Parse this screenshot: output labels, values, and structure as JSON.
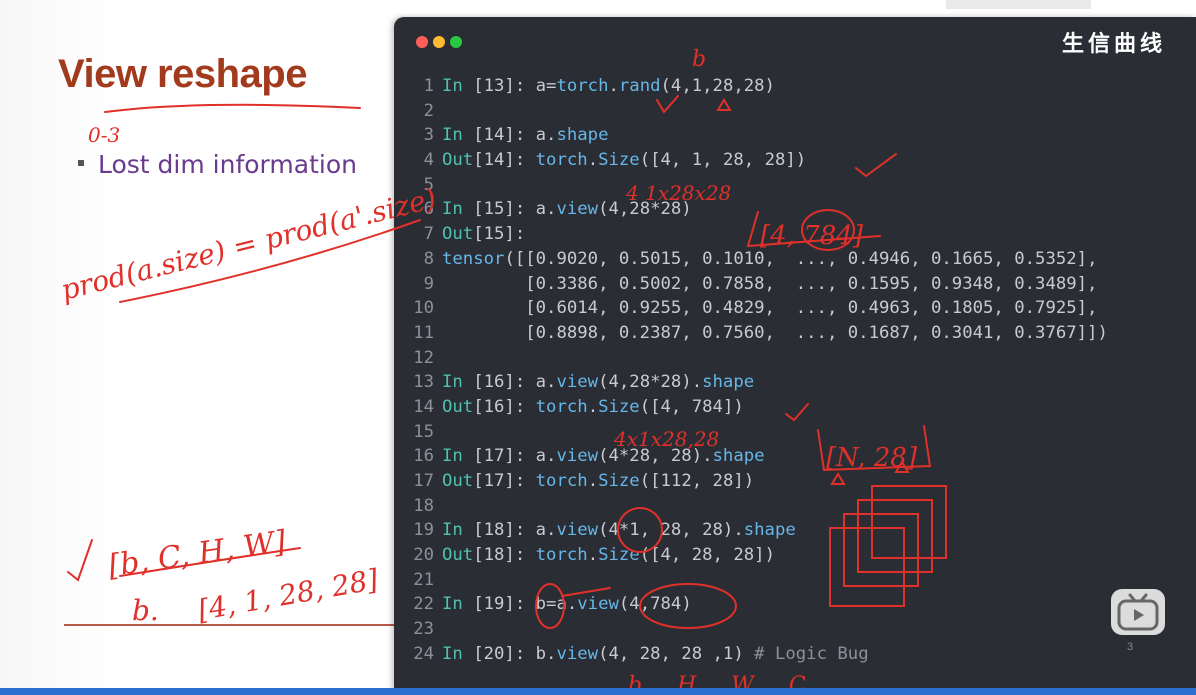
{
  "slide": {
    "title": "View reshape",
    "bullet": "Lost dim information"
  },
  "terminal": {
    "watermark": "生信曲线",
    "lines": [
      {
        "n": "1",
        "parts": [
          [
            "kw",
            "In "
          ],
          [
            "",
            "[13]: a="
          ],
          [
            "fn",
            "torch"
          ],
          [
            "",
            "."
          ],
          [
            "fn",
            "rand"
          ],
          [
            "",
            "(4,1,28,28)"
          ]
        ]
      },
      {
        "n": "2",
        "parts": []
      },
      {
        "n": "3",
        "parts": [
          [
            "kw",
            "In "
          ],
          [
            "",
            "[14]: a."
          ],
          [
            "fn",
            "shape"
          ]
        ]
      },
      {
        "n": "4",
        "parts": [
          [
            "kw",
            "Out"
          ],
          [
            "",
            "[14]: "
          ],
          [
            "fn",
            "torch"
          ],
          [
            "",
            "."
          ],
          [
            "fn",
            "Size"
          ],
          [
            "",
            "([4, 1, 28, 28])"
          ]
        ]
      },
      {
        "n": "5",
        "parts": []
      },
      {
        "n": "6",
        "parts": [
          [
            "kw",
            "In "
          ],
          [
            "",
            "[15]: a."
          ],
          [
            "fn",
            "view"
          ],
          [
            "",
            "(4,28*28)"
          ]
        ]
      },
      {
        "n": "7",
        "parts": [
          [
            "kw",
            "Out"
          ],
          [
            "",
            "[15]:"
          ]
        ]
      },
      {
        "n": "8",
        "parts": [
          [
            "fn",
            "tensor"
          ],
          [
            "",
            "([[0.9020, 0.5015, 0.1010,  ..., 0.4946, 0.1665, 0.5352],"
          ]
        ]
      },
      {
        "n": "9",
        "parts": [
          [
            "",
            "        [0.3386, 0.5002, 0.7858,  ..., 0.1595, 0.9348, 0.3489],"
          ]
        ]
      },
      {
        "n": "10",
        "parts": [
          [
            "",
            "        [0.6014, 0.9255, 0.4829,  ..., 0.4963, 0.1805, 0.7925],"
          ]
        ]
      },
      {
        "n": "11",
        "parts": [
          [
            "",
            "        [0.8898, 0.2387, 0.7560,  ..., 0.1687, 0.3041, 0.3767]])"
          ]
        ]
      },
      {
        "n": "12",
        "parts": []
      },
      {
        "n": "13",
        "parts": [
          [
            "kw",
            "In "
          ],
          [
            "",
            "[16]: a."
          ],
          [
            "fn",
            "view"
          ],
          [
            "",
            "(4,28*28)."
          ],
          [
            "fn",
            "shape"
          ]
        ]
      },
      {
        "n": "14",
        "parts": [
          [
            "kw",
            "Out"
          ],
          [
            "",
            "[16]: "
          ],
          [
            "fn",
            "torch"
          ],
          [
            "",
            "."
          ],
          [
            "fn",
            "Size"
          ],
          [
            "",
            "([4, 784])"
          ]
        ]
      },
      {
        "n": "15",
        "parts": []
      },
      {
        "n": "16",
        "parts": [
          [
            "kw",
            "In "
          ],
          [
            "",
            "[17]: a."
          ],
          [
            "fn",
            "view"
          ],
          [
            "",
            "(4*28, 28)."
          ],
          [
            "fn",
            "shape"
          ]
        ]
      },
      {
        "n": "17",
        "parts": [
          [
            "kw",
            "Out"
          ],
          [
            "",
            "[17]: "
          ],
          [
            "fn",
            "torch"
          ],
          [
            "",
            "."
          ],
          [
            "fn",
            "Size"
          ],
          [
            "",
            "([112, 28])"
          ]
        ]
      },
      {
        "n": "18",
        "parts": []
      },
      {
        "n": "19",
        "parts": [
          [
            "kw",
            "In "
          ],
          [
            "",
            "[18]: a."
          ],
          [
            "fn",
            "view"
          ],
          [
            "",
            "(4*1, 28, 28)."
          ],
          [
            "fn",
            "shape"
          ]
        ]
      },
      {
        "n": "20",
        "parts": [
          [
            "kw",
            "Out"
          ],
          [
            "",
            "[18]: "
          ],
          [
            "fn",
            "torch"
          ],
          [
            "",
            "."
          ],
          [
            "fn",
            "Size"
          ],
          [
            "",
            "([4, 28, 28])"
          ]
        ]
      },
      {
        "n": "21",
        "parts": []
      },
      {
        "n": "22",
        "parts": [
          [
            "kw",
            "In "
          ],
          [
            "",
            "[19]: b=a."
          ],
          [
            "fn",
            "view"
          ],
          [
            "",
            "(4,784)"
          ]
        ]
      },
      {
        "n": "23",
        "parts": []
      },
      {
        "n": "24",
        "parts": [
          [
            "kw",
            "In "
          ],
          [
            "",
            "[20]: b."
          ],
          [
            "fn",
            "view"
          ],
          [
            "",
            "(4, 28, 28 ,1) "
          ],
          [
            "cm",
            "# Logic Bug"
          ]
        ]
      }
    ]
  },
  "annotations": {
    "left": [
      "0-3",
      "prod(a.size) = prod(a'.size)",
      "[b, C, H, W]",
      "b.",
      "[4, 1, 28, 28]"
    ],
    "code": [
      "b",
      "4 1x28x28",
      "[4, 784]",
      "4x1x28,28",
      "[N, 28]",
      "b H W C"
    ]
  },
  "player": {
    "page_number": "3"
  },
  "colors": {
    "title": "#a23b1d",
    "bullet": "#6a3a8f",
    "terminal_bg": "#2a2d34",
    "keyword": "#4fc1b0",
    "function": "#66b6e8",
    "ink": "#e0302a"
  }
}
